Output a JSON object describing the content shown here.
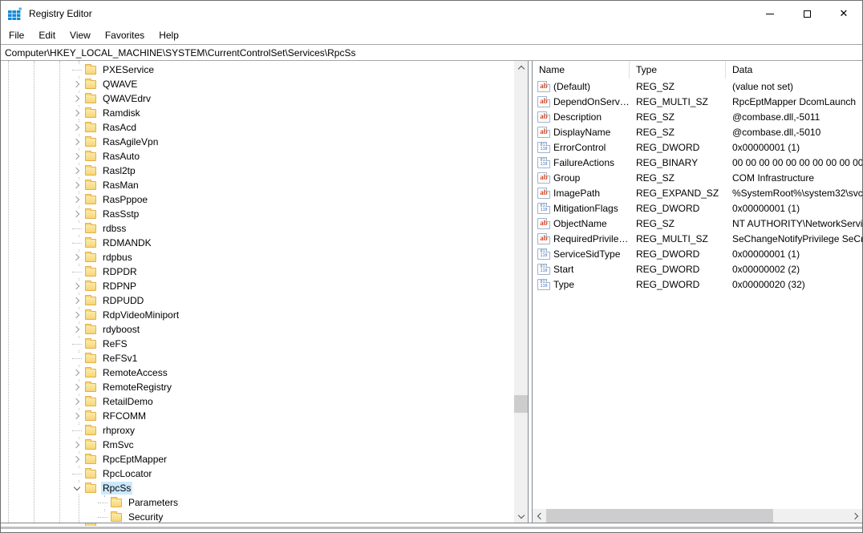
{
  "window": {
    "title": "Registry Editor",
    "controls": {
      "minimize": "minimize",
      "maximize": "maximize",
      "close": "✕"
    }
  },
  "menu": {
    "items": [
      "File",
      "Edit",
      "View",
      "Favorites",
      "Help"
    ]
  },
  "address_bar": {
    "value": "Computer\\HKEY_LOCAL_MACHINE\\SYSTEM\\CurrentControlSet\\Services\\RpcSs"
  },
  "tree": {
    "items": [
      {
        "label": "PXEService",
        "chevron": "none",
        "level": 0,
        "selected": false
      },
      {
        "label": "QWAVE",
        "chevron": "collapsed",
        "level": 0,
        "selected": false
      },
      {
        "label": "QWAVEdrv",
        "chevron": "collapsed",
        "level": 0,
        "selected": false
      },
      {
        "label": "Ramdisk",
        "chevron": "collapsed",
        "level": 0,
        "selected": false
      },
      {
        "label": "RasAcd",
        "chevron": "collapsed",
        "level": 0,
        "selected": false
      },
      {
        "label": "RasAgileVpn",
        "chevron": "collapsed",
        "level": 0,
        "selected": false
      },
      {
        "label": "RasAuto",
        "chevron": "collapsed",
        "level": 0,
        "selected": false
      },
      {
        "label": "Rasl2tp",
        "chevron": "collapsed",
        "level": 0,
        "selected": false
      },
      {
        "label": "RasMan",
        "chevron": "collapsed",
        "level": 0,
        "selected": false
      },
      {
        "label": "RasPppoe",
        "chevron": "collapsed",
        "level": 0,
        "selected": false
      },
      {
        "label": "RasSstp",
        "chevron": "collapsed",
        "level": 0,
        "selected": false
      },
      {
        "label": "rdbss",
        "chevron": "none",
        "level": 0,
        "selected": false
      },
      {
        "label": "RDMANDK",
        "chevron": "none",
        "level": 0,
        "selected": false
      },
      {
        "label": "rdpbus",
        "chevron": "collapsed",
        "level": 0,
        "selected": false
      },
      {
        "label": "RDPDR",
        "chevron": "none",
        "level": 0,
        "selected": false
      },
      {
        "label": "RDPNP",
        "chevron": "collapsed",
        "level": 0,
        "selected": false
      },
      {
        "label": "RDPUDD",
        "chevron": "collapsed",
        "level": 0,
        "selected": false
      },
      {
        "label": "RdpVideoMiniport",
        "chevron": "collapsed",
        "level": 0,
        "selected": false
      },
      {
        "label": "rdyboost",
        "chevron": "collapsed",
        "level": 0,
        "selected": false
      },
      {
        "label": "ReFS",
        "chevron": "none",
        "level": 0,
        "selected": false
      },
      {
        "label": "ReFSv1",
        "chevron": "none",
        "level": 0,
        "selected": false
      },
      {
        "label": "RemoteAccess",
        "chevron": "collapsed",
        "level": 0,
        "selected": false
      },
      {
        "label": "RemoteRegistry",
        "chevron": "collapsed",
        "level": 0,
        "selected": false
      },
      {
        "label": "RetailDemo",
        "chevron": "collapsed",
        "level": 0,
        "selected": false
      },
      {
        "label": "RFCOMM",
        "chevron": "collapsed",
        "level": 0,
        "selected": false
      },
      {
        "label": "rhproxy",
        "chevron": "none",
        "level": 0,
        "selected": false
      },
      {
        "label": "RmSvc",
        "chevron": "collapsed",
        "level": 0,
        "selected": false
      },
      {
        "label": "RpcEptMapper",
        "chevron": "collapsed",
        "level": 0,
        "selected": false
      },
      {
        "label": "RpcLocator",
        "chevron": "none",
        "level": 0,
        "selected": false
      },
      {
        "label": "RpcSs",
        "chevron": "expanded",
        "level": 0,
        "selected": true
      },
      {
        "label": "Parameters",
        "chevron": "none",
        "level": 1,
        "selected": false
      },
      {
        "label": "Security",
        "chevron": "none",
        "level": 1,
        "selected": false
      }
    ]
  },
  "values": {
    "columns": [
      "Name",
      "Type",
      "Data"
    ],
    "rows": [
      {
        "icon": "string",
        "name": "(Default)",
        "type": "REG_SZ",
        "data": "(value not set)"
      },
      {
        "icon": "string",
        "name": "DependOnService",
        "type": "REG_MULTI_SZ",
        "data": "RpcEptMapper DcomLaunch"
      },
      {
        "icon": "string",
        "name": "Description",
        "type": "REG_SZ",
        "data": "@combase.dll,-5011"
      },
      {
        "icon": "string",
        "name": "DisplayName",
        "type": "REG_SZ",
        "data": "@combase.dll,-5010"
      },
      {
        "icon": "binary",
        "name": "ErrorControl",
        "type": "REG_DWORD",
        "data": "0x00000001 (1)"
      },
      {
        "icon": "binary",
        "name": "FailureActions",
        "type": "REG_BINARY",
        "data": "00 00 00 00 00 00 00 00 00 00 00 00"
      },
      {
        "icon": "string",
        "name": "Group",
        "type": "REG_SZ",
        "data": "COM Infrastructure"
      },
      {
        "icon": "string",
        "name": "ImagePath",
        "type": "REG_EXPAND_SZ",
        "data": "%SystemRoot%\\system32\\svc"
      },
      {
        "icon": "binary",
        "name": "MitigationFlags",
        "type": "REG_DWORD",
        "data": "0x00000001 (1)"
      },
      {
        "icon": "string",
        "name": "ObjectName",
        "type": "REG_SZ",
        "data": "NT AUTHORITY\\NetworkServi"
      },
      {
        "icon": "string",
        "name": "RequiredPrivileg...",
        "type": "REG_MULTI_SZ",
        "data": "SeChangeNotifyPrivilege SeCr"
      },
      {
        "icon": "binary",
        "name": "ServiceSidType",
        "type": "REG_DWORD",
        "data": "0x00000001 (1)"
      },
      {
        "icon": "binary",
        "name": "Start",
        "type": "REG_DWORD",
        "data": "0x00000002 (2)"
      },
      {
        "icon": "binary",
        "name": "Type",
        "type": "REG_DWORD",
        "data": "0x00000020 (32)"
      }
    ]
  },
  "icons": {
    "string_glyph": "ab",
    "dword_glyph_top": "011",
    "dword_glyph_bottom": "110"
  },
  "colors": {
    "selection": "#cce8ff",
    "folder_fill": "#f7d675",
    "folder_border": "#e3af4a",
    "app_icon_blue": "#1789d8",
    "string_icon_red": "#d0421b",
    "dword_icon_blue": "#3b6eb5"
  }
}
